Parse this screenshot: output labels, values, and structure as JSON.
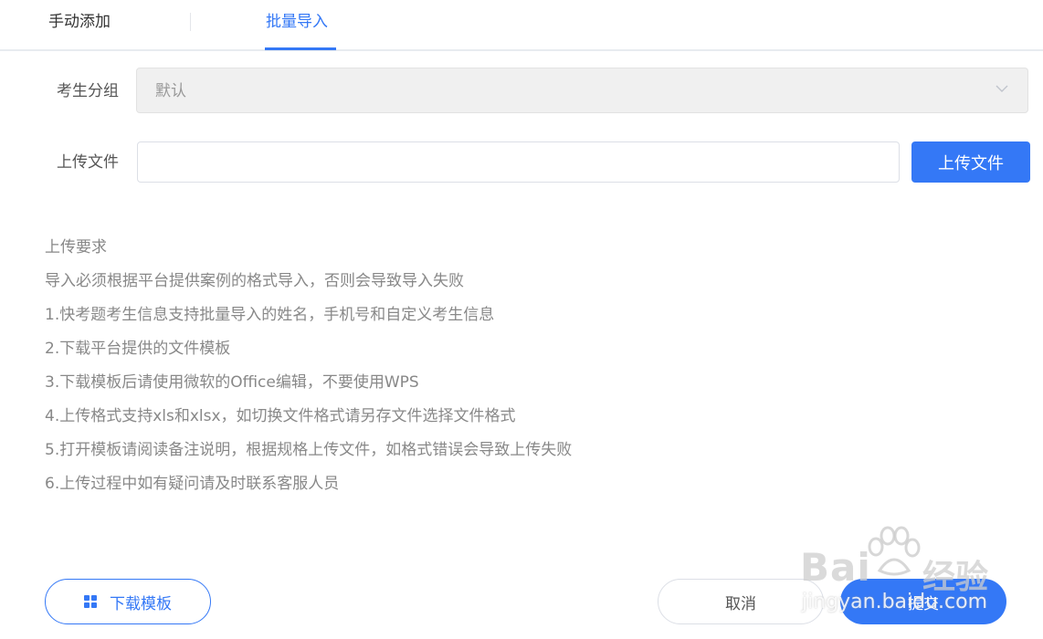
{
  "tabs": {
    "manual": "手动添加",
    "batch": "批量导入",
    "active": "batch"
  },
  "form": {
    "group_label": "考生分组",
    "group_value": "默认",
    "file_label": "上传文件",
    "file_value": "",
    "upload_button": "上传文件"
  },
  "requirements": {
    "title": "上传要求",
    "lines": [
      "导入必须根据平台提供案例的格式导入，否则会导致导入失败",
      "1.快考题考生信息支持批量导入的姓名，手机号和自定义考生信息",
      "2.下载平台提供的文件模板",
      "3.下载模板后请使用微软的Office编辑，不要使用WPS",
      "4.上传格式支持xls和xlsx，如切换文件格式请另存文件选择文件格式",
      "5.打开模板请阅读备注说明，根据规格上传文件，如格式错误会导致上传失败",
      "6.上传过程中如有疑问请及时联系客服人员"
    ]
  },
  "footer": {
    "download_label": "下载模板",
    "cancel_label": "取消",
    "submit_label": "提交"
  },
  "watermark": {
    "brand": "Bai",
    "brand_cn": "经验",
    "url": "jingyan.baidu.com"
  },
  "colors": {
    "accent": "#3478f6",
    "muted_text": "#888888",
    "disabled_bg": "#f0f0f0"
  },
  "icons": {
    "select_arrow": "chevron-down-icon",
    "download": "grid-icon"
  }
}
